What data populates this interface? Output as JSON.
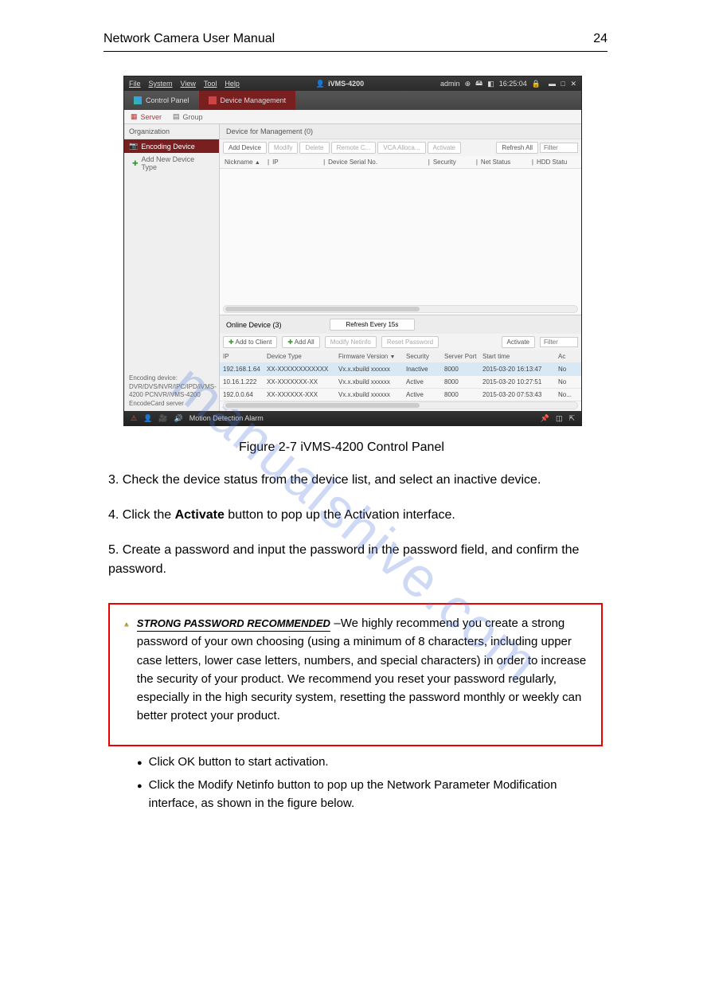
{
  "page_header": "Network Camera User Manual",
  "page_number": "24",
  "app": {
    "title": "iVMS-4200",
    "menus": [
      "File",
      "System",
      "View",
      "Tool",
      "Help"
    ],
    "user": "admin",
    "clock": "16:25:04",
    "tabs": {
      "control_panel": "Control Panel",
      "device_mgmt": "Device Management"
    },
    "subtabs": {
      "server": "Server",
      "group": "Group"
    }
  },
  "sidebar": {
    "organization": "Organization",
    "encoding_device": "Encoding Device",
    "add_new": "Add New Device Type",
    "desc_title": "Encoding device:",
    "desc_body": "DVR/DVS/NVR/IPC/IPD/iVMS-4200 PCNVR/iVMS-4200 EncodeCard server"
  },
  "mgmt": {
    "title": "Device for Management (0)",
    "buttons": {
      "add": "Add Device",
      "modify": "Modify",
      "delete": "Delete",
      "remote": "Remote C...",
      "vca": "VCA Alloca...",
      "activate": "Activate",
      "refresh": "Refresh All"
    },
    "filter_placeholder": "Filter",
    "cols": {
      "nickname": "Nickname",
      "ip": "IP",
      "serial": "Device Serial No.",
      "security": "Security",
      "net": "Net Status",
      "hdd": "HDD Statu"
    }
  },
  "online": {
    "title": "Online Device (3)",
    "refresh": "Refresh Every 15s",
    "buttons": {
      "add_client": "Add to Client",
      "add_all": "Add All",
      "modify": "Modify Netinfo",
      "reset": "Reset Password",
      "activate": "Activate"
    },
    "filter_placeholder": "Filter",
    "cols": {
      "ip": "IP",
      "dtype": "Device Type",
      "fw": "Firmware Version",
      "sec": "Security",
      "sport": "Server Port",
      "stime": "Start time",
      "ac": "Ac"
    },
    "rows": [
      {
        "ip": "192.168.1.64",
        "dtype": "XX-XXXXXXXXXXXX",
        "fw": "Vx.x.xbuild xxxxxx",
        "sec": "Inactive",
        "sport": "8000",
        "stime": "2015-03-20 16:13:47",
        "ac": "No"
      },
      {
        "ip": "10.16.1.222",
        "dtype": "XX-XXXXXXX-XX",
        "fw": "Vx.x.xbuild xxxxxx",
        "sec": "Active",
        "sport": "8000",
        "stime": "2015-03-20 10:27:51",
        "ac": "No"
      },
      {
        "ip": "192.0.0.64",
        "dtype": "XX-XXXXXX-XXX",
        "fw": "Vx.x.xbuild xxxxxx",
        "sec": "Active",
        "sport": "8000",
        "stime": "2015-03-20 07:53:43",
        "ac": "No..."
      }
    ]
  },
  "statusbar": {
    "alarm": "Motion Detection Alarm"
  },
  "figure_label": "Figure 2-7 iVMS-4200 Control Panel",
  "para1_num": "3.",
  "para1": "Check the device status from the device list, and select an inactive device.",
  "para2_num": "4.",
  "para2_a": "Click the ",
  "para2_b": "Activate",
  "para2_c": " button to pop up the Activation interface.",
  "para3_num": "5.",
  "para3": "Create a password and input the password in the password field, and confirm the password.",
  "strong": {
    "title": "STRONG PASSWORD RECOMMENDED",
    "body": "–We highly recommend you create a strong password of your own choosing (using a minimum of 8 characters, including upper case letters, lower case letters, numbers, and special characters) in order to increase the security of your product. We recommend you reset your password regularly, especially in the high security system, resetting the password monthly or weekly can better protect your product."
  },
  "bullets": [
    "Click OK button to start activation.",
    "Click the Modify Netinfo button to pop up the Network Parameter Modification interface, as shown in the figure below."
  ],
  "watermark": "manualshive.com"
}
